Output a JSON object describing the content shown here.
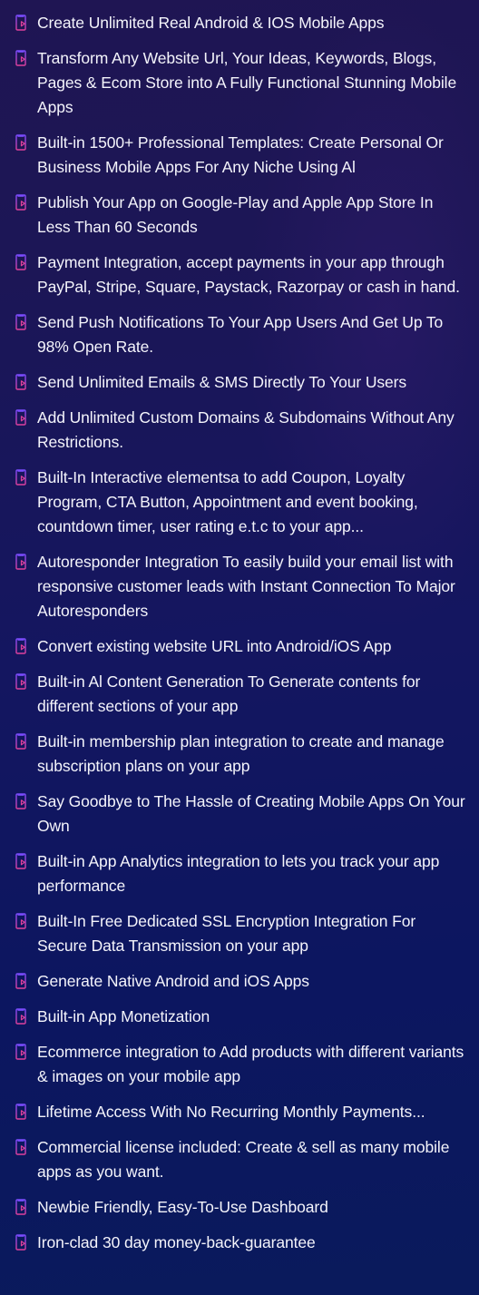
{
  "colors": {
    "background_top": "#1f1553",
    "background_bottom": "#0a1a5c",
    "icon_gradient_start": "#7b4cff",
    "icon_gradient_end": "#e0409c",
    "text": "#f4f4fb"
  },
  "features": {
    "icon": "phone-play-icon",
    "items": [
      {
        "text": "Create Unlimited Real  Android & IOS Mobile Apps"
      },
      {
        "text": "Transform Any Website Url, Your Ideas, Keywords, Blogs, Pages & Ecom Store into A Fully Functional Stunning Mobile Apps"
      },
      {
        "text": "Built-in 1500+ Professional Templates: Create Personal Or Business Mobile Apps For Any Niche Using Al"
      },
      {
        "text": "Publish Your App on Google-Play and Apple App Store In Less Than 60 Seconds"
      },
      {
        "text": "Payment Integration, accept payments in your app through PayPal, Stripe, Square, Paystack, Razorpay or cash in hand."
      },
      {
        "text": "Send Push Notifications To Your App Users And Get Up To 98% Open Rate."
      },
      {
        "text": "Send Unlimited Emails & SMS Directly To Your Users"
      },
      {
        "text": "Add Unlimited Custom Domains & Subdomains Without Any Restrictions."
      },
      {
        "text": "Built-In Interactive elementsa to add Coupon, Loyalty Program, CTA Button, Appointment and event booking, countdown timer, user rating e.t.c to your app..."
      },
      {
        "text": "Autoresponder Integration To easily build your email list with responsive customer leads with Instant Connection To Major Autoresponders"
      },
      {
        "text": "Convert existing website URL into Android/iOS App"
      },
      {
        "text": "Built-in Al Content Generation To Generate contents for different sections of your app"
      },
      {
        "text": "Built-in membership plan integration to create and manage subscription plans on your app"
      },
      {
        "text": "Say Goodbye to The Hassle of Creating Mobile Apps On Your Own"
      },
      {
        "text": "Built-in App Analytics integration to lets you track your app performance"
      },
      {
        "text": "Built-In Free Dedicated SSL Encryption Integration For Secure Data Transmission on your app"
      },
      {
        "text": "Generate Native Android and iOS Apps"
      },
      {
        "text": "Built-in App Monetization"
      },
      {
        "text": "Ecommerce integration to Add products with different variants & images on your mobile app"
      },
      {
        "text": "Lifetime Access With No Recurring Monthly Payments..."
      },
      {
        "text": "Commercial license included: Create & sell as many mobile apps as you want."
      },
      {
        "text": "Newbie Friendly, Easy-To-Use Dashboard"
      },
      {
        "text": "Iron-clad 30 day money-back-guarantee"
      }
    ]
  }
}
